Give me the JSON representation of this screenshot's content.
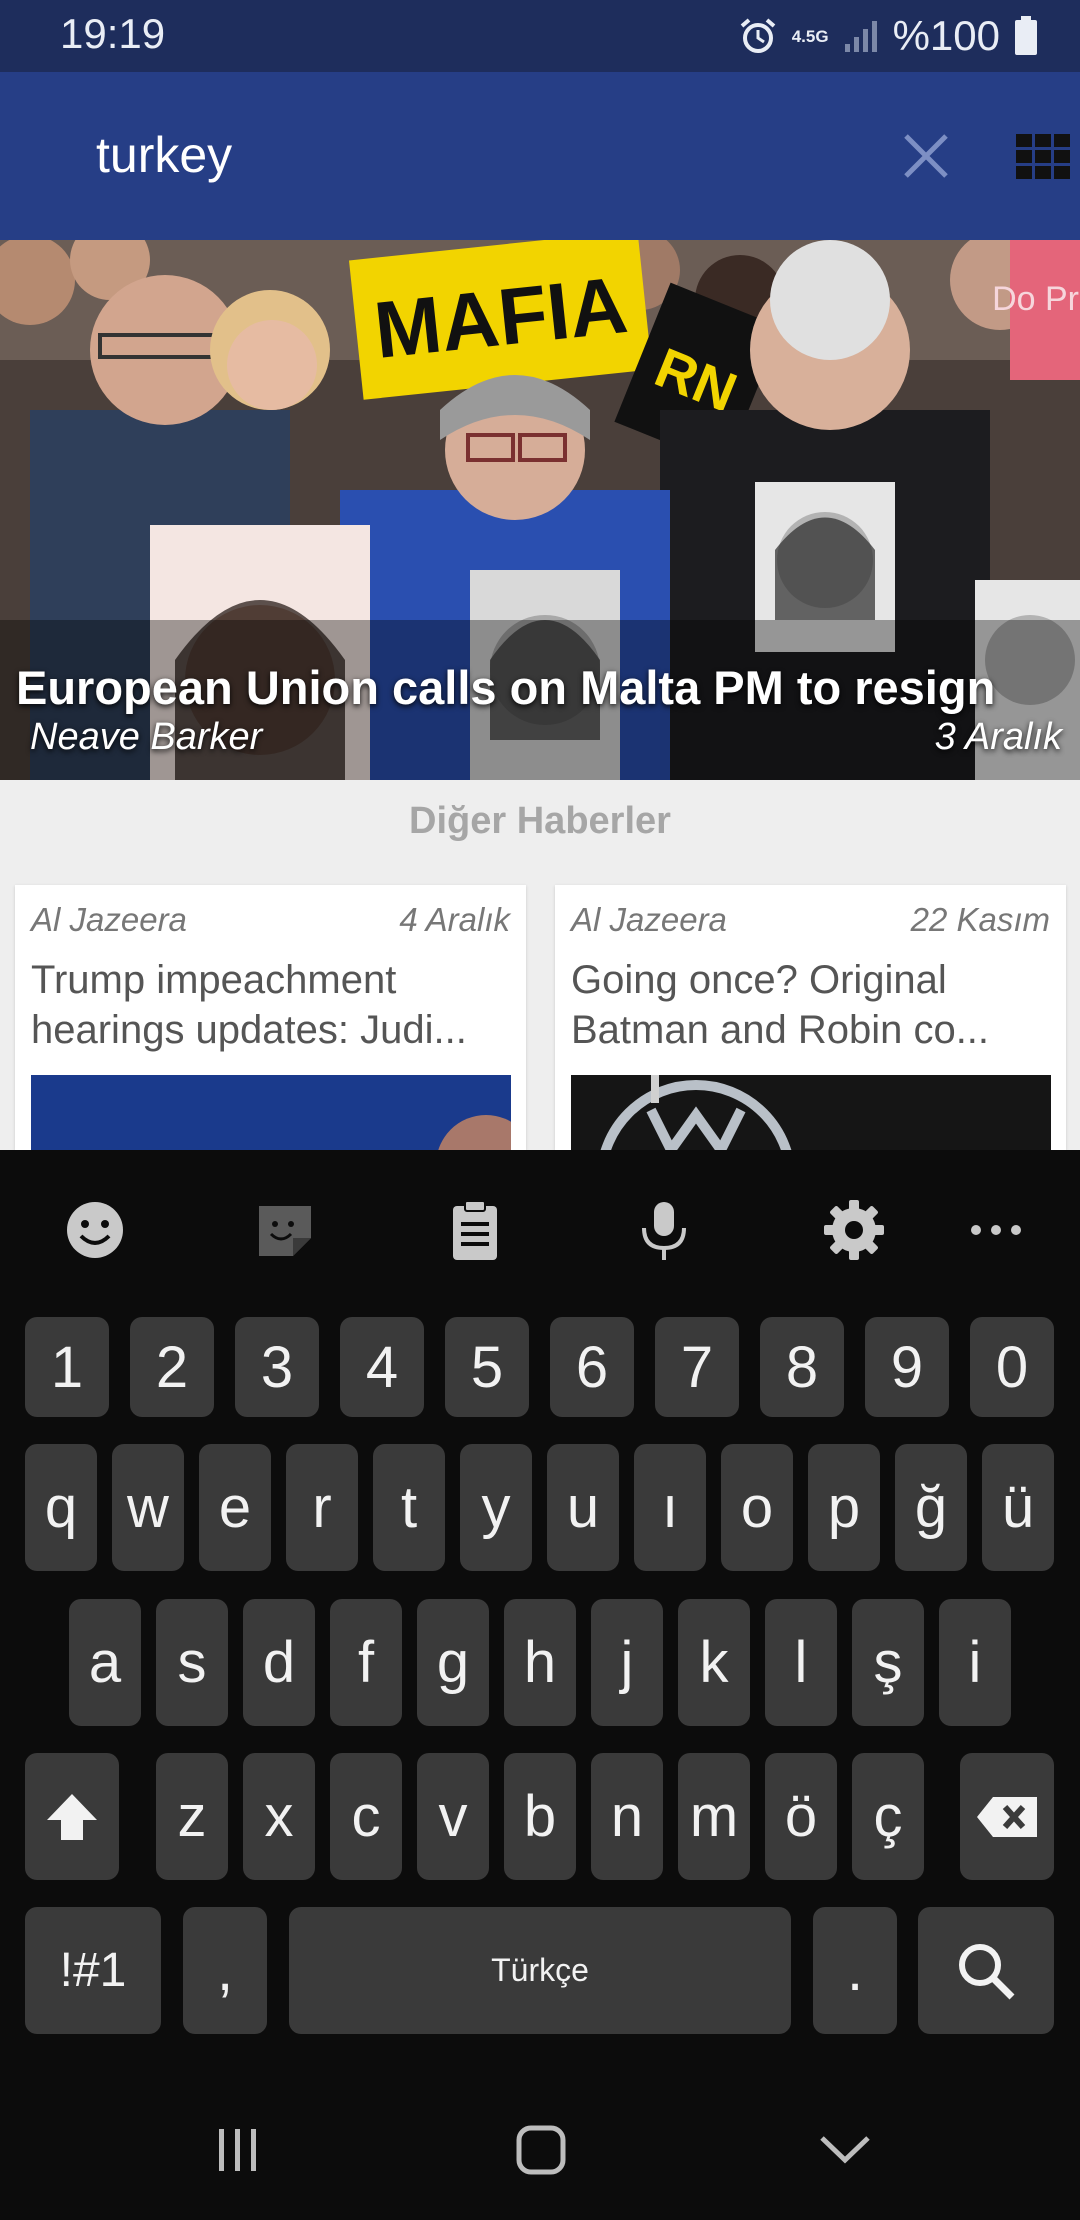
{
  "status_bar": {
    "time": "19:19",
    "network": "4.5G",
    "battery": "%100"
  },
  "search": {
    "query": "turkey"
  },
  "hero": {
    "title": "European Union calls on Malta PM to resign",
    "author": "Neave Barker",
    "date": "3 Aralık",
    "photo_signs": {
      "sign_main": "MAFIA",
      "sign_tilted": "RN",
      "sign_right": "Do Pro"
    }
  },
  "section": {
    "title": "Diğer Haberler"
  },
  "cards": [
    {
      "source": "Al Jazeera",
      "date": "4 Aralık",
      "title": "Trump impeachment hearings updates: Judi..."
    },
    {
      "source": "Al Jazeera",
      "date": "22 Kasım",
      "title": "Going once? Original Batman and Robin co..."
    }
  ],
  "keyboard": {
    "numbers": [
      "1",
      "2",
      "3",
      "4",
      "5",
      "6",
      "7",
      "8",
      "9",
      "0"
    ],
    "row1": [
      "q",
      "w",
      "e",
      "r",
      "t",
      "y",
      "u",
      "ı",
      "o",
      "p",
      "ğ",
      "ü"
    ],
    "row2": [
      "a",
      "s",
      "d",
      "f",
      "g",
      "h",
      "j",
      "k",
      "l",
      "ş",
      "i"
    ],
    "row3": [
      "z",
      "x",
      "c",
      "v",
      "b",
      "n",
      "m",
      "ö",
      "ç"
    ],
    "symbols_key": "!#1",
    "comma": ",",
    "space_label": "Türkçe",
    "period": "."
  },
  "colors": {
    "status_bar": "#1e2d5c",
    "app_bar": "#263e86",
    "section_bg": "#eeeeee",
    "keyboard_bg": "#0c0c0c",
    "key_bg": "#3a3a3a"
  },
  "icons": [
    "alarm-icon",
    "signal-icon",
    "battery-icon",
    "close-icon",
    "grid-view-icon",
    "emoji-icon",
    "sticker-icon",
    "clipboard-icon",
    "microphone-icon",
    "settings-icon",
    "more-icon",
    "shift-icon",
    "backspace-icon",
    "search-icon",
    "recents-icon",
    "home-icon",
    "back-icon"
  ]
}
